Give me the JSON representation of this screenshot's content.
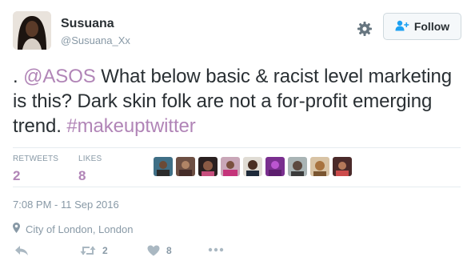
{
  "user": {
    "name": "Susuana",
    "handle": "@Susuana_Xx"
  },
  "follow_label": "Follow",
  "tweet": {
    "lead": ". ",
    "mention": "@ASOS",
    "body": " What below basic & racist level marketing is this? Dark skin folk are not a for-profit emerging trend. ",
    "hashtag": "#makeuptwitter"
  },
  "stats": {
    "retweets_label": "RETWEETS",
    "retweets_value": "2",
    "likes_label": "LIKES",
    "likes_value": "8"
  },
  "timestamp": "7:08 PM - 11 Sep 2016",
  "location": "City of London, London",
  "actions": {
    "retweet_count": "2",
    "like_count": "8"
  },
  "colors": {
    "accent": "#b185b7",
    "muted": "#8899a6",
    "text": "#292f33",
    "border": "#e6ecf0"
  },
  "icons": [
    "gear-icon",
    "follow-person-plus-icon",
    "location-pin-icon",
    "reply-icon",
    "retweet-icon",
    "heart-icon",
    "more-icon"
  ]
}
